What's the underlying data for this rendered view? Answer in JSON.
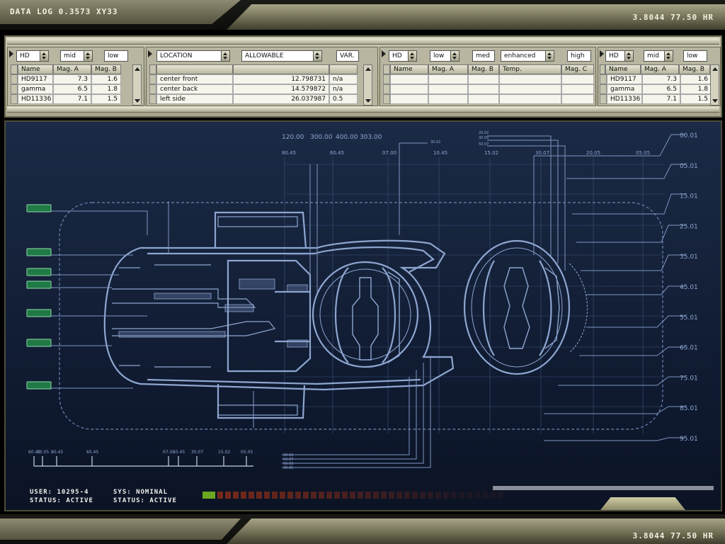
{
  "header": {
    "title": "DATA LOG 0.3573 XY33",
    "readout": "3.8044 77.50 HR"
  },
  "footer": {
    "readout": "3.8044 77.50 HR"
  },
  "panel": {
    "group1": {
      "catalog": "HD",
      "mid": "mid",
      "low": "low",
      "columns": [
        "Name",
        "Mag. A",
        "Mag. B"
      ],
      "rows": [
        [
          "HD9117",
          "7.3",
          "1.6"
        ],
        [
          "gamma",
          "6.5",
          "1.8"
        ],
        [
          "HD11336",
          "7.1",
          "1.5"
        ]
      ]
    },
    "group2": {
      "location": "LOCATION",
      "allowable": "ALLOWABLE",
      "var": "VAR.",
      "rows": [
        [
          "center front",
          "12.798731",
          "n/a"
        ],
        [
          "center back",
          "14.579872",
          "n/a"
        ],
        [
          "left side",
          "26.037987",
          "0.5"
        ]
      ]
    },
    "group3": {
      "catalog": "HD",
      "low": "low",
      "med": "med",
      "enhanced": "enhanced",
      "high": "high",
      "columns": [
        "Name",
        "Mag. A",
        "Mag. B",
        "Temp.",
        "Mag. C"
      ]
    },
    "group4": {
      "catalog": "HD",
      "mid": "mid",
      "low": "low",
      "columns": [
        "Name",
        "Mag. A",
        "Mag. B"
      ],
      "rows": [
        [
          "HD9117",
          "7.3",
          "1.6"
        ],
        [
          "gamma",
          "6.5",
          "1.8"
        ],
        [
          "HD11336",
          "7.1",
          "1.5"
        ]
      ]
    }
  },
  "blueprint": {
    "top_values": [
      "120.00",
      "300.00",
      "400.00",
      "303.00"
    ],
    "top_ticks": [
      "80.45",
      "60.45",
      "07.00",
      "10.45",
      "15.02",
      "30.07",
      "20.05",
      "05.05"
    ],
    "small_labels_top": [
      "30.02",
      "20.02",
      "30.05",
      "50.07"
    ],
    "right_scale": [
      "00.01",
      "05.01",
      "15.01",
      "25.01",
      "35.01",
      "45.01",
      "55.01",
      "65.01",
      "75.01",
      "85.01",
      "95.01"
    ],
    "bottom_ruler": [
      "60.45",
      "10.05",
      "80.45",
      "60.45",
      "07.00",
      "10.45",
      "30.07",
      "15.02",
      "05.05"
    ],
    "small_labels_bottom": [
      "20.02",
      "10.07",
      "50.03",
      "30.05"
    ],
    "line_color": "#8ea6d0",
    "indicator_color": "#1f7a45"
  },
  "status": {
    "user": "USER: 10295-4",
    "status_left": "STATUS: ACTIVE",
    "sys": "SYS: NOMINAL",
    "status_right": "STATUS: ACTIVE",
    "progress_segments": 38,
    "progress_lit": 1,
    "lit_color": "#6aa620",
    "seg_color": "#7a2a1a"
  }
}
